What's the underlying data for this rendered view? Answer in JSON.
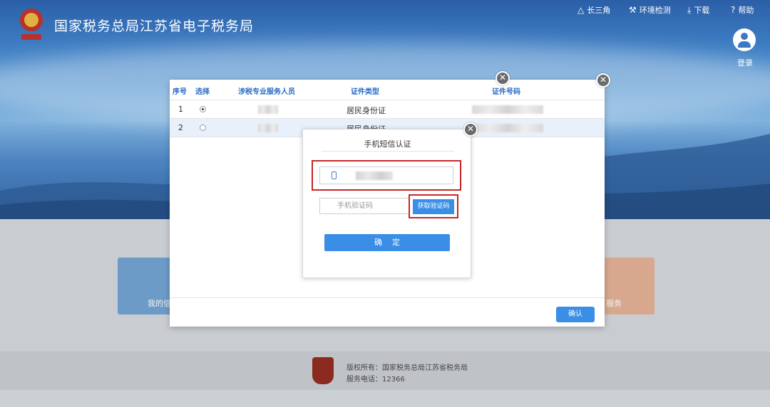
{
  "header": {
    "title": "国家税务总局江苏省电子税务局",
    "nav": [
      {
        "label": "长三角",
        "icon": "triangle-icon"
      },
      {
        "label": "环境检测",
        "icon": "wrench-icon"
      },
      {
        "label": "下载",
        "icon": "download-icon"
      },
      {
        "label": "帮助",
        "icon": "help-icon"
      }
    ],
    "login_label": "登录"
  },
  "tiles": {
    "left_label": "我的信",
    "right_label": "服务"
  },
  "footer": {
    "copyright": "版权所有：国家税务总局江苏省税务局",
    "service_phone": "服务电话：12366"
  },
  "outer_dialog": {
    "columns": [
      "序号",
      "选择",
      "涉税专业服务人员",
      "证件类型",
      "证件号码"
    ],
    "rows": [
      {
        "index": "1",
        "selected": true,
        "id_type": "居民身份证"
      },
      {
        "index": "2",
        "selected": false,
        "id_type": "居民身份证"
      }
    ],
    "ok_label": "确认"
  },
  "sms_dialog": {
    "title": "手机短信认证",
    "code_placeholder": "手机验证码",
    "get_code_label": "获取验证码",
    "confirm_label": "确定"
  },
  "colors": {
    "accent": "#3a8ee6",
    "highlight": "#c62828",
    "header_text": "#2b6cc4"
  }
}
